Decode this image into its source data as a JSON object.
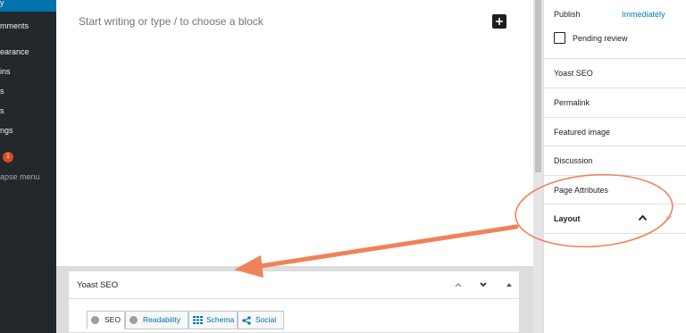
{
  "admin_menu": {
    "items": [
      {
        "label": "y"
      },
      {
        "label": "mments"
      },
      {
        "label": "earance"
      },
      {
        "label": "ins"
      },
      {
        "label": "s"
      },
      {
        "label": "s"
      },
      {
        "label": "ngs"
      },
      {
        "label": ""
      },
      {
        "label": "apse menu"
      }
    ],
    "badge_count": "1"
  },
  "editor": {
    "placeholder": "Start writing or type / to choose a block",
    "add_block_icon": "plus-icon"
  },
  "metabox": {
    "title": "Yoast SEO",
    "tabs": [
      {
        "label": "SEO",
        "icon": "circle-dot-icon"
      },
      {
        "label": "Readability",
        "icon": "circle-dot-icon"
      },
      {
        "label": "Schema",
        "icon": "grid-icon"
      },
      {
        "label": "Social",
        "icon": "share-icon"
      }
    ]
  },
  "settings": {
    "publish_label": "Publish",
    "publish_value": "Immediately",
    "pending_review_label": "Pending review",
    "panels": [
      {
        "label": "Yoast SEO"
      },
      {
        "label": "Permalink"
      },
      {
        "label": "Featured image"
      },
      {
        "label": "Discussion"
      },
      {
        "label": "Page Attributes"
      },
      {
        "label": "Layout"
      }
    ]
  },
  "colors": {
    "admin_bg": "#23282d",
    "accent_blue": "#007cba",
    "annotation_orange": "#f0825a",
    "badge_red": "#d54e21"
  }
}
